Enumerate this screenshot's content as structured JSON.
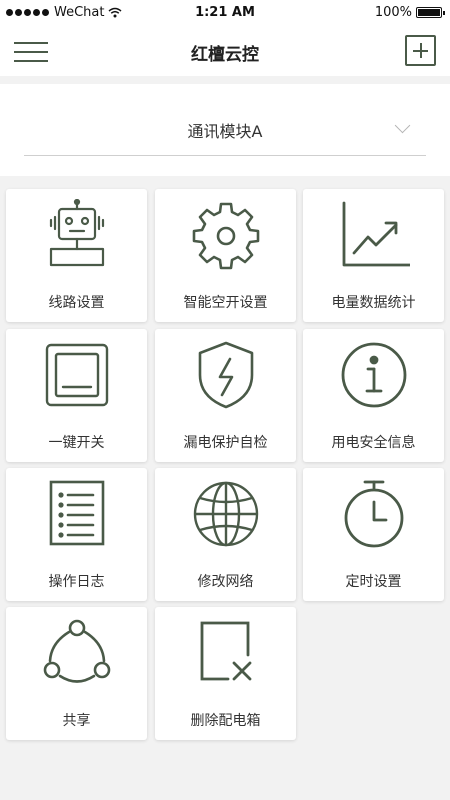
{
  "status_bar": {
    "carrier": "WeChat",
    "time": "1:21 AM",
    "battery": "100%"
  },
  "header": {
    "title": "红檀云控"
  },
  "module_selector": {
    "value": "通讯模块A"
  },
  "theme": {
    "icon_color": "#4a5a48"
  },
  "tiles": [
    {
      "label": "线路设置",
      "icon": "robot-icon"
    },
    {
      "label": "智能空开设置",
      "icon": "gear-icon"
    },
    {
      "label": "电量数据统计",
      "icon": "trend-chart-icon"
    },
    {
      "label": "一键开关",
      "icon": "switch-icon"
    },
    {
      "label": "漏电保护自检",
      "icon": "shield-bolt-icon"
    },
    {
      "label": "用电安全信息",
      "icon": "info-icon"
    },
    {
      "label": "操作日志",
      "icon": "list-icon"
    },
    {
      "label": "修改网络",
      "icon": "globe-icon"
    },
    {
      "label": "定时设置",
      "icon": "stopwatch-icon"
    },
    {
      "label": "共享",
      "icon": "share-icon"
    },
    {
      "label": "删除配电箱",
      "icon": "delete-box-icon"
    }
  ]
}
